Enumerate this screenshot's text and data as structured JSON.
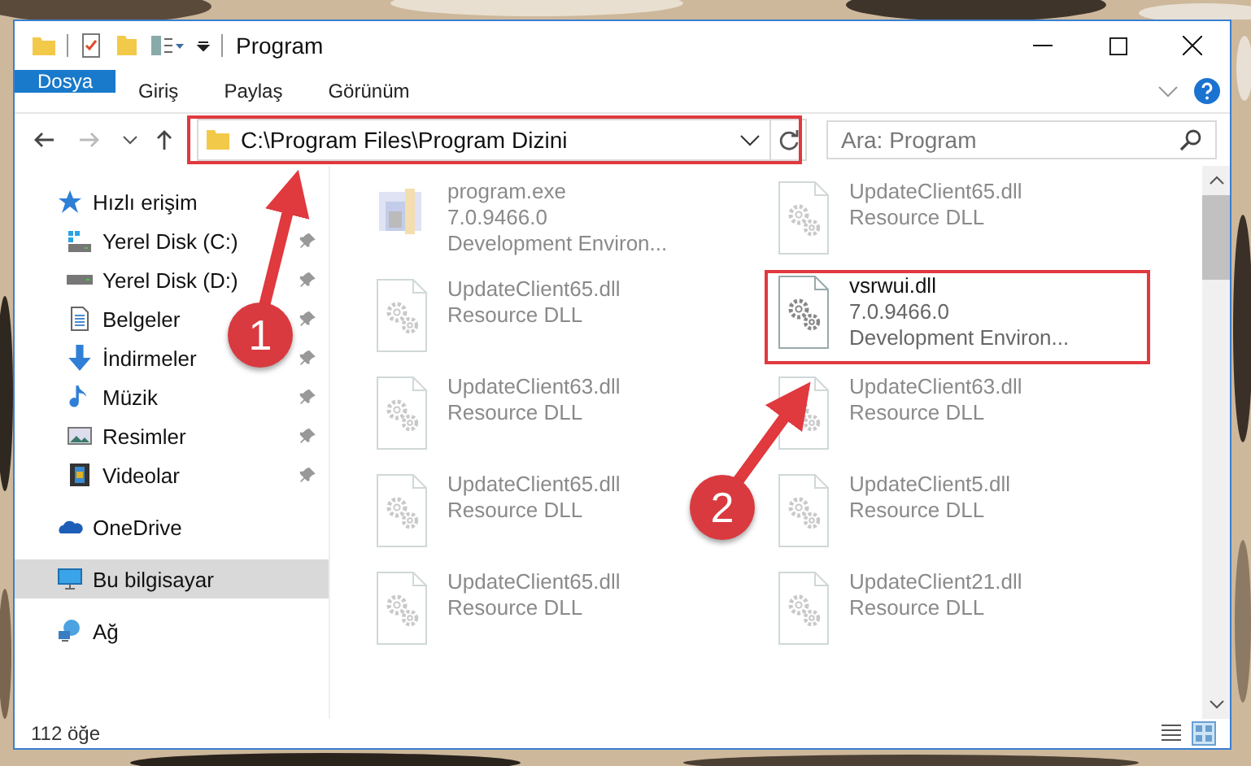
{
  "window": {
    "title": "Program"
  },
  "ribbon_tabs": [
    {
      "label": "Dosya",
      "kind": "file"
    },
    {
      "label": "Giriş",
      "kind": "tab"
    },
    {
      "label": "Paylaş",
      "kind": "tab"
    },
    {
      "label": "Görünüm",
      "kind": "tab"
    }
  ],
  "address": {
    "value": "C:\\Program Files\\Program Dizini"
  },
  "search": {
    "placeholder": "Ara: Program"
  },
  "sidebar": {
    "items": [
      {
        "label": "Hızlı erişim",
        "selected": false,
        "children": [
          {
            "label": "Yerel Disk (C:)",
            "pinned": true,
            "selected": false
          },
          {
            "label": "Yerel Disk (D:)",
            "pinned": true,
            "selected": false
          },
          {
            "label": "Belgeler",
            "pinned": true,
            "selected": false
          },
          {
            "label": "İndirmeler",
            "pinned": true,
            "selected": false
          },
          {
            "label": "Müzik",
            "pinned": true,
            "selected": false
          },
          {
            "label": "Resimler",
            "pinned": true,
            "selected": false
          },
          {
            "label": "Videolar",
            "pinned": true,
            "selected": false
          }
        ]
      },
      {
        "label": "OneDrive",
        "selected": false
      },
      {
        "label": "Bu bilgisayar",
        "selected": true
      },
      {
        "label": "Ağ",
        "selected": false
      }
    ]
  },
  "files": [
    {
      "name": "program.exe",
      "kind": "exe",
      "details": [
        "7.0.9466.0",
        "Development Environ..."
      ],
      "blurred": true,
      "highlighted": false
    },
    {
      "name": "UpdateClient65.dll",
      "kind": "dll",
      "details": [
        "Resource DLL"
      ],
      "blurred": true,
      "highlighted": false
    },
    {
      "name": "UpdateClient65.dll",
      "kind": "dll",
      "details": [
        "Resource DLL"
      ],
      "blurred": true,
      "highlighted": false
    },
    {
      "name": "vsrwui.dll",
      "kind": "dll",
      "details": [
        "7.0.9466.0",
        "Development Environ..."
      ],
      "blurred": false,
      "highlighted": true
    },
    {
      "name": "UpdateClient63.dll",
      "kind": "dll",
      "details": [
        "Resource DLL"
      ],
      "blurred": true,
      "highlighted": false
    },
    {
      "name": "UpdateClient63.dll",
      "kind": "dll",
      "details": [
        "Resource DLL"
      ],
      "blurred": true,
      "highlighted": false
    },
    {
      "name": "UpdateClient65.dll",
      "kind": "dll",
      "details": [
        "Resource DLL"
      ],
      "blurred": true,
      "highlighted": false
    },
    {
      "name": "UpdateClient5.dll",
      "kind": "dll",
      "details": [
        "Resource DLL"
      ],
      "blurred": true,
      "highlighted": false
    },
    {
      "name": "UpdateClient65.dll",
      "kind": "dll",
      "details": [
        "Resource DLL"
      ],
      "blurred": true,
      "highlighted": false
    },
    {
      "name": "UpdateClient21.dll",
      "kind": "dll",
      "details": [
        "Resource DLL"
      ],
      "blurred": true,
      "highlighted": false
    }
  ],
  "annotations": [
    {
      "number": "1"
    },
    {
      "number": "2"
    }
  ],
  "status_bar": {
    "count": "112 öğe"
  }
}
